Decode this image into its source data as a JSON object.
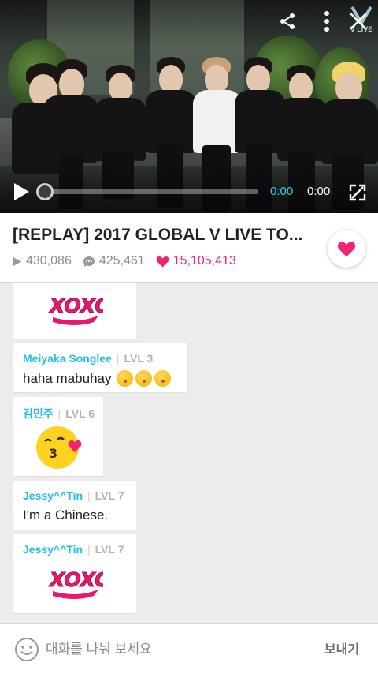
{
  "player": {
    "current_time": "0:00",
    "duration": "0:00",
    "progress_fraction": 0.0,
    "logo_text": "V LIVE",
    "icons": [
      "share-icon",
      "more-vertical-icon",
      "close-icon",
      "play-icon",
      "fullscreen-icon"
    ]
  },
  "video_info": {
    "title": "[REPLAY] 2017 GLOBAL V LIVE TO...",
    "views": "430,086",
    "comments": "425,461",
    "likes": "15,105,413"
  },
  "chat": {
    "messages": [
      {
        "type": "sticker",
        "sticker": "xoxo"
      },
      {
        "type": "text",
        "name": "Meiyaka Songlee",
        "level": "LVL 3",
        "text": "haha mabuhay",
        "emojis": 3
      },
      {
        "type": "sticker",
        "name": "김민주",
        "level": "LVL 6",
        "sticker": "kiss-face"
      },
      {
        "type": "text",
        "name": "Jessy^^Tin",
        "level": "LVL 7",
        "text": "I'm a Chinese."
      },
      {
        "type": "sticker",
        "name": "Jessy^^Tin",
        "level": "LVL 7",
        "sticker": "xoxo"
      }
    ]
  },
  "input_bar": {
    "placeholder": "대화를 나눠 보세요",
    "send_label": "보내기"
  },
  "colors": {
    "accent": "#21BFE8",
    "like_pink": "#F02476",
    "background": "#ECECEC"
  }
}
